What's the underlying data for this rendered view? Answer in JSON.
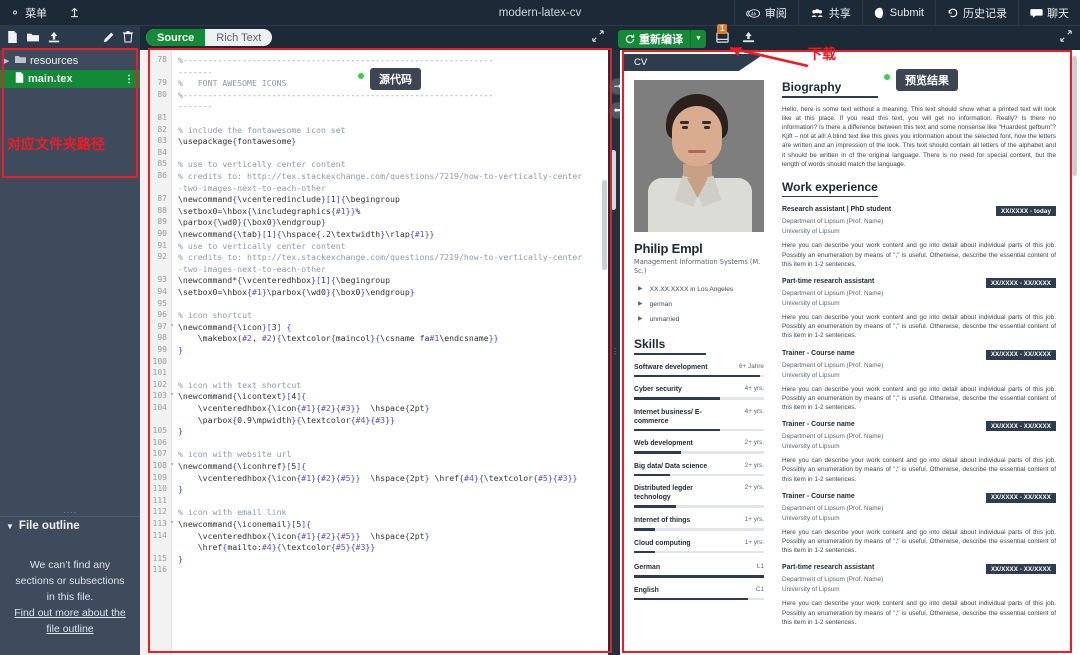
{
  "topbar": {
    "menu_label": "菜单",
    "title": "modern-latex-cv",
    "back_icon": "back-to-projects-icon",
    "items": [
      {
        "label": "审阅",
        "icon": "review-icon"
      },
      {
        "label": "共享",
        "icon": "share-icon"
      },
      {
        "label": "Submit",
        "icon": "submit-icon"
      },
      {
        "label": "历史记录",
        "icon": "history-icon"
      },
      {
        "label": "聊天",
        "icon": "chat-icon"
      }
    ]
  },
  "filetools": {
    "new_file": "new-file-icon",
    "new_folder": "new-folder-icon",
    "upload": "upload-icon",
    "rename": "rename-pencil-icon",
    "delete": "delete-trash-icon"
  },
  "mode_switch": {
    "source": "Source",
    "rich_text": "Rich Text"
  },
  "compile": {
    "recompile_label": "重新编译",
    "caret": "▼",
    "log_badge": "1",
    "log_icon": "compile-log-icon",
    "download_icon": "download-pdf-icon"
  },
  "sidebar": {
    "tree": [
      {
        "name": "resources",
        "type": "folder",
        "selected": false
      },
      {
        "name": "main.tex",
        "type": "file",
        "selected": true
      }
    ],
    "outline": {
      "title": "File outline",
      "empty_line1": "We can’t find any",
      "empty_line2": "sections or subsections",
      "empty_line3": "in this file.",
      "link1": "Find out more about the",
      "link2": "file outline"
    }
  },
  "editor": {
    "lines": [
      {
        "n": "78",
        "t": "%---------------------------------------------------------------",
        "cls": "cmt"
      },
      {
        "n": "",
        "t": "-------",
        "cls": "cmt"
      },
      {
        "n": "79",
        "t": "%   FONT AWESOME ICONS",
        "cls": "cmt"
      },
      {
        "n": "80",
        "t": "%---------------------------------------------------------------",
        "cls": "cmt"
      },
      {
        "n": "",
        "t": "-------",
        "cls": "cmt"
      },
      {
        "n": "81",
        "t": "",
        "cls": "cmt"
      },
      {
        "n": "82",
        "t": "% include the fontawesome icon set",
        "cls": "cmt"
      },
      {
        "n": "83",
        "t": "\\usepackage{fontawesome}",
        "cls": "kw"
      },
      {
        "n": "84",
        "t": "",
        "cls": "cmt"
      },
      {
        "n": "85",
        "t": "% use to vertically center content",
        "cls": "cmt"
      },
      {
        "n": "86",
        "t": "% credits to: http://tex.stackexchange.com/questions/7219/how-to-vertically-center",
        "cls": "cmt"
      },
      {
        "n": "",
        "t": "-two-images-next-to-each-other",
        "cls": "cmt"
      },
      {
        "n": "87",
        "t": "\\newcommand{\\vcenteredinclude}[1]{\\begingroup",
        "cls": "kw"
      },
      {
        "n": "88",
        "t": "\\setbox0=\\hbox{\\includegraphics{#1}}%",
        "cls": "kw"
      },
      {
        "n": "89",
        "t": "\\parbox{\\wd0}{\\box0}\\endgroup}",
        "cls": "kw"
      },
      {
        "n": "90",
        "t": "\\newcommand{\\tab}[1]{\\hspace{.2\\textwidth}\\rlap{#1}}",
        "cls": "kw"
      },
      {
        "n": "91",
        "t": "% use to vertically center content",
        "cls": "cmt"
      },
      {
        "n": "92",
        "t": "% credits to: http://tex.stackexchange.com/questions/7219/how-to-vertically-center",
        "cls": "cmt"
      },
      {
        "n": "",
        "t": "-two-images-next-to-each-other",
        "cls": "cmt"
      },
      {
        "n": "93",
        "t": "\\newcommand*{\\vcenteredhbox}[1]{\\begingroup",
        "cls": "kw"
      },
      {
        "n": "94",
        "t": "\\setbox0=\\hbox{#1}\\parbox{\\wd0}{\\box0}\\endgroup}",
        "cls": "kw"
      },
      {
        "n": "95",
        "t": "",
        "cls": "cmt"
      },
      {
        "n": "96",
        "t": "% icon shortcut",
        "cls": "cmt"
      },
      {
        "n": "97",
        "t": "\\newcommand{\\icon}[3] {",
        "cls": "kw",
        "fold": true
      },
      {
        "n": "98",
        "t": "    \\makebox(#2, #2){\\textcolor{maincol}{\\csname fa#1\\endcsname}}",
        "cls": "kw"
      },
      {
        "n": "99",
        "t": "}",
        "cls": "kw"
      },
      {
        "n": "100",
        "t": "",
        "cls": "cmt"
      },
      {
        "n": "101",
        "t": "",
        "cls": "cmt"
      },
      {
        "n": "102",
        "t": "% icon with text shortcut",
        "cls": "cmt"
      },
      {
        "n": "103",
        "t": "\\newcommand{\\icontext}[4]{",
        "cls": "kw",
        "fold": true
      },
      {
        "n": "104",
        "t": "    \\vcenteredhbox{\\icon{#1}{#2}{#3}}  \\hspace{2pt}",
        "cls": "kw"
      },
      {
        "n": "",
        "t": "    \\parbox{0.9\\mpwidth}{\\textcolor{#4}{#3}}",
        "cls": "kw"
      },
      {
        "n": "105",
        "t": "}",
        "cls": "kw"
      },
      {
        "n": "106",
        "t": "",
        "cls": "cmt"
      },
      {
        "n": "107",
        "t": "% icon with website url",
        "cls": "cmt"
      },
      {
        "n": "108",
        "t": "\\newcommand{\\iconhref}[5]{",
        "cls": "kw",
        "fold": true
      },
      {
        "n": "109",
        "t": "    \\vcenteredhbox{\\icon{#1}{#2}{#5}}  \\hspace{2pt} \\href{#4}{\\textcolor{#5}{#3}}",
        "cls": "kw"
      },
      {
        "n": "110",
        "t": "}",
        "cls": "kw"
      },
      {
        "n": "111",
        "t": "",
        "cls": "cmt"
      },
      {
        "n": "112",
        "t": "% icon with email link",
        "cls": "cmt"
      },
      {
        "n": "113",
        "t": "\\newcommand{\\iconemail}[5]{",
        "cls": "kw",
        "fold": true
      },
      {
        "n": "114",
        "t": "    \\vcenteredhbox{\\icon{#1}{#2}{#5}}  \\hspace{2pt}",
        "cls": "kw"
      },
      {
        "n": "",
        "t": "    \\href{mailto:#4}{\\textcolor{#5}{#3}}",
        "cls": "kw"
      },
      {
        "n": "115",
        "t": "}",
        "cls": "kw"
      },
      {
        "n": "116",
        "t": "",
        "cls": "cmt"
      }
    ]
  },
  "preview": {
    "tab_label": "CV",
    "name": "Philip Empl",
    "subtitle": "Management Information Systems (M. Sc.)",
    "bullets": [
      "XX.XX.XXXX in Los Angeles",
      "german",
      "unmarried"
    ],
    "biography": {
      "heading": "Biography",
      "text": "Hello, here is some text without a meaning. This text should show what a printed text will look like at this place. If you read this text, you will get no information. Really? Is there no information? Is there a difference between this text and some nonsense like “Huardest gefburn”? Kjift – not at all! A blind text like this gives you information about the selected font, how the letters are written and an impression of the look. This text should contain all letters of the alphabet and it should be written in of the original language. There is no need for special content, but the length of words should match the language."
    },
    "skills_heading": "Skills",
    "skills": [
      {
        "name": "Software development",
        "years": "6+ Jahre",
        "pct": 97
      },
      {
        "name": "Cyber security",
        "years": "4+ yrs.",
        "pct": 66
      },
      {
        "name": "Internet business/ E-commerce",
        "years": "4+ yrs.",
        "pct": 66
      },
      {
        "name": "Web development",
        "years": "2+ yrs.",
        "pct": 36
      },
      {
        "name": "Big data/ Data science",
        "years": "2+ yrs.",
        "pct": 28
      },
      {
        "name": "Distributed legder technology",
        "years": "2+ yrs.",
        "pct": 32
      },
      {
        "name": "Internet of things",
        "years": "1+ yrs.",
        "pct": 16
      },
      {
        "name": "Cloud computing",
        "years": "1+ yrs.",
        "pct": 16
      }
    ],
    "languages": [
      {
        "name": "German",
        "level": "L1",
        "pct": 100
      },
      {
        "name": "English",
        "level": "C1",
        "pct": 88
      }
    ],
    "work_heading": "Work experience",
    "work": [
      {
        "title": "Research assistant | PhD student",
        "date": "XX/XXXX - today",
        "org1": "Department of Lipsum (Prof. Name)",
        "org2": "University of Lipsum",
        "desc": "Here you can describe your work content and go into detail about individual parts of this job. Possibly an enumeration by means of \",\" is useful. Otherwise, describe the essential content of this item in 1-2 sentences."
      },
      {
        "title": "Part-time research assistant",
        "date": "XX/XXXX - XX/XXXX",
        "org1": "Department of Lipsum (Prof. Name)",
        "org2": "University of Lipsum",
        "desc": "Here you can describe your work content and go into detail about individual parts of this job. Possibly an enumeration by means of \",\" is useful. Otherwise, describe the essential content of this item in 1-2 sentences."
      },
      {
        "title": "Trainer - Course name",
        "date": "XX/XXXX - XX/XXXX",
        "org1": "Department of Lipsum (Prof. Name)",
        "org2": "University of Lipsum",
        "desc": "Here you can describe your work content and go into detail about individual parts of this job. Possibly an enumeration by means of \",\" is useful. Otherwise, describe the essential content of this item in 1-2 sentences."
      },
      {
        "title": "Trainer - Course name",
        "date": "XX/XXXX - XX/XXXX",
        "org1": "Department of Lipsum (Prof. Name)",
        "org2": "University of Lipsum",
        "desc": "Here you can describe your work content and go into detail about individual parts of this job. Possibly an enumeration by means of \",\" is useful. Otherwise, describe the essential content of this item in 1-2 sentences."
      },
      {
        "title": "Trainer - Course name",
        "date": "XX/XXXX - XX/XXXX",
        "org1": "Department of Lipsum (Prof. Name)",
        "org2": "University of Lipsum",
        "desc": "Here you can describe your work content and go into detail about individual parts of this job. Possibly an enumeration by means of \",\" is useful. Otherwise, describe the essential content of this item in 1-2 sentences."
      },
      {
        "title": "Part-time research assistant",
        "date": "XX/XXXX - XX/XXXX",
        "org1": "Department of Lipsum (Prof. Name)",
        "org2": "University of Lipsum",
        "desc": "Here you can describe your work content and go into detail about individual parts of this job. Possibly an enumeration by means of \",\" is useful. Otherwise, describe the essential content of this item in 1-2 sentences."
      }
    ]
  },
  "annotations": {
    "source_tag": "源代码",
    "preview_tag": "预览结果",
    "folder_path_label": "对应文件夹路径",
    "download_label": "下载"
  },
  "colors": {
    "accent_green": "#138a36",
    "annotation_red": "#ee1c25",
    "cv_dark": "#2e3d4e",
    "chrome_dark": "#1c2a38",
    "sidebar": "#3d4b5c"
  }
}
